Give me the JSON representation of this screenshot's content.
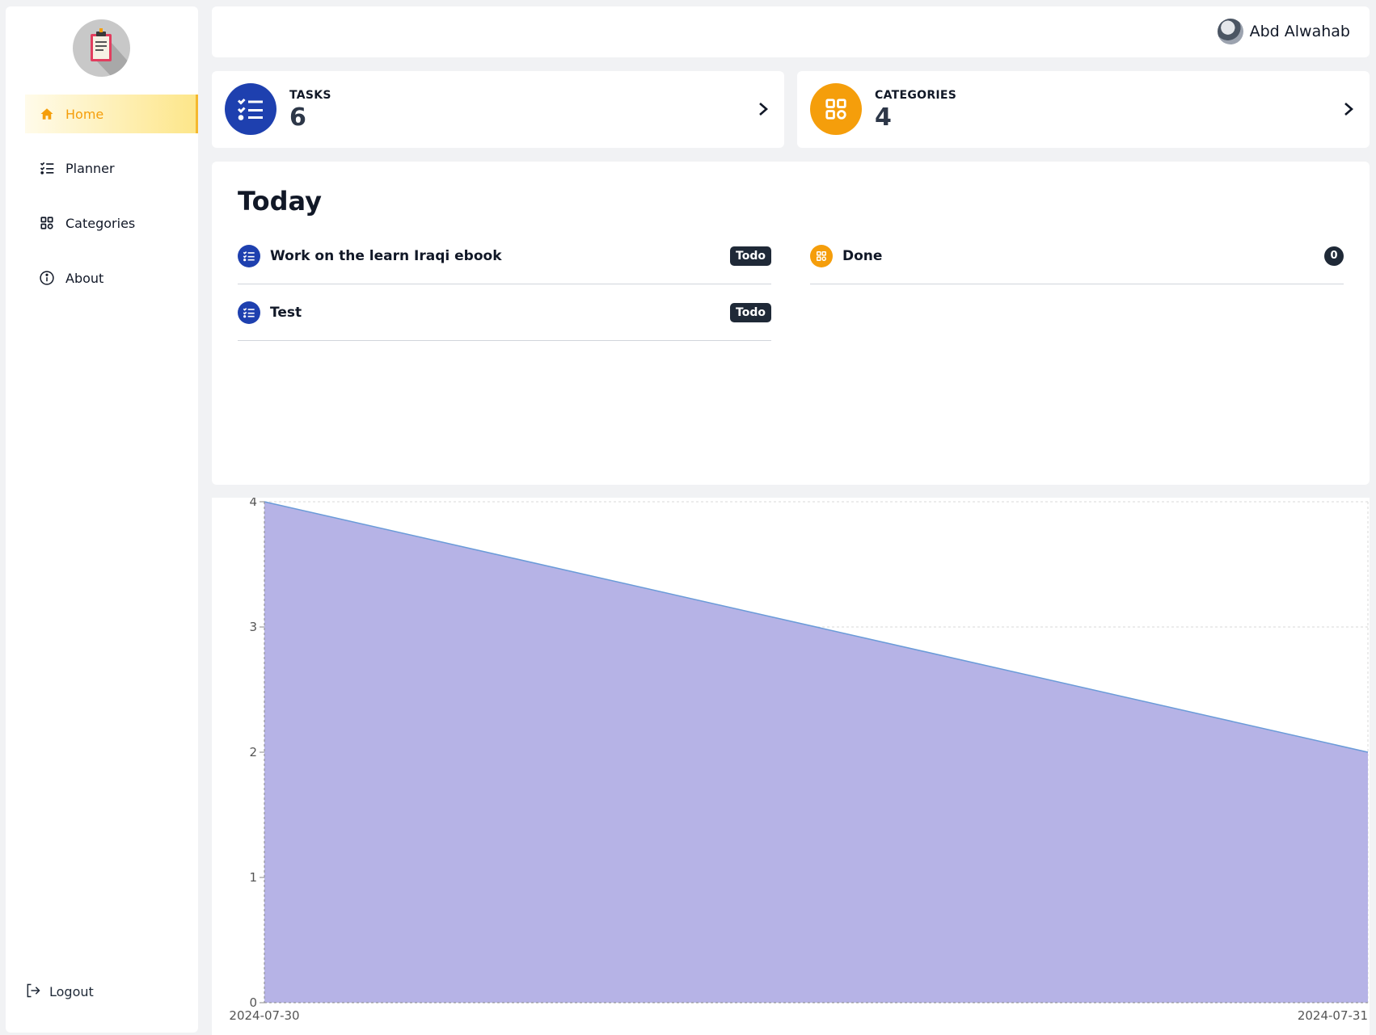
{
  "sidebar": {
    "items": [
      {
        "label": "Home",
        "icon": "home-icon",
        "active": true
      },
      {
        "label": "Planner",
        "icon": "list-check-icon",
        "active": false
      },
      {
        "label": "Categories",
        "icon": "grid-icon",
        "active": false
      },
      {
        "label": "About",
        "icon": "info-icon",
        "active": false
      }
    ],
    "logout_label": "Logout"
  },
  "header": {
    "user_name": "Abd Alwahab"
  },
  "stats": {
    "tasks": {
      "label": "TASKS",
      "count": "6",
      "color": "#1e40af"
    },
    "categories": {
      "label": "CATEGORIES",
      "count": "4",
      "color": "#f59e0b"
    }
  },
  "today": {
    "title": "Today",
    "tasks": [
      {
        "name": "Work on the learn Iraqi ebook",
        "status": "Todo"
      },
      {
        "name": "Test",
        "status": "Todo"
      }
    ],
    "categories": [
      {
        "name": "Done",
        "count": "0"
      }
    ]
  },
  "chart_data": {
    "type": "area",
    "x": [
      "2024-07-30",
      "2024-07-31"
    ],
    "series": [
      {
        "values": [
          4,
          2
        ]
      }
    ],
    "ylim": [
      0,
      4
    ],
    "yticks": [
      0,
      1,
      2,
      3,
      4
    ],
    "grid": true,
    "fill_color": "#b6b3e6",
    "line_color": "#6a9bd8"
  }
}
